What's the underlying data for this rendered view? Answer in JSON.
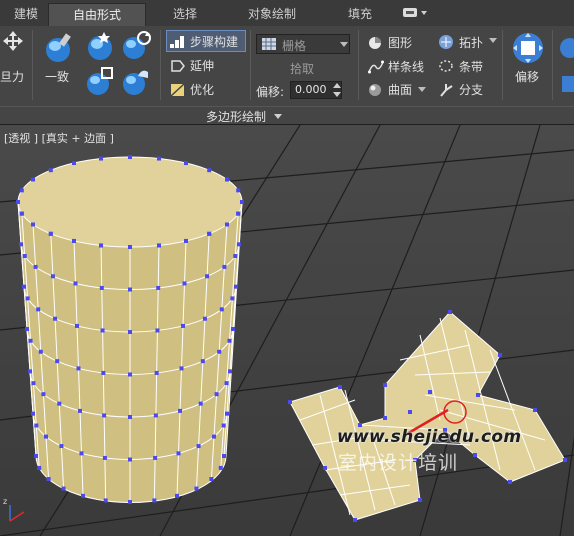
{
  "tabs": [
    "建模",
    "自由形式",
    "选择",
    "对象绘制",
    "填充"
  ],
  "active_tab": "自由形式",
  "ribbon": {
    "left_clipped": "旦力",
    "conform": "一致",
    "step_build": "步骤构建",
    "extend": "延伸",
    "optimize": "优化",
    "grid_label": "栅格",
    "pick": "拾取",
    "offset_label": "偏移:",
    "offset_value": "0.000",
    "shapes": "图形",
    "splines": "样条线",
    "surface": "曲面",
    "topology": "拓扑",
    "strips": "条带",
    "branches": "分支",
    "offset_big": "偏移",
    "section_title": "多边形绘制"
  },
  "icons": [
    "move-icon",
    "conform-brush-icon",
    "step-build-icon",
    "extend-icon",
    "optimize-icon",
    "grid-icon",
    "shapes-icon",
    "splines-icon",
    "surface-icon",
    "topology-icon",
    "strips-icon",
    "branches-icon",
    "offset-icon",
    "dropdown-arrow-icon"
  ],
  "viewport": {
    "label": "[透视 ] [真实 + 边面 ]",
    "watermark_url": "www.shejiedu.com",
    "watermark_cn": "室内设计培训"
  },
  "colors": {
    "mesh_fill": "#e0d29a",
    "vertex": "#4a4af0",
    "grid_line": "#1e1e1e",
    "accent": "#6a8cbf"
  }
}
